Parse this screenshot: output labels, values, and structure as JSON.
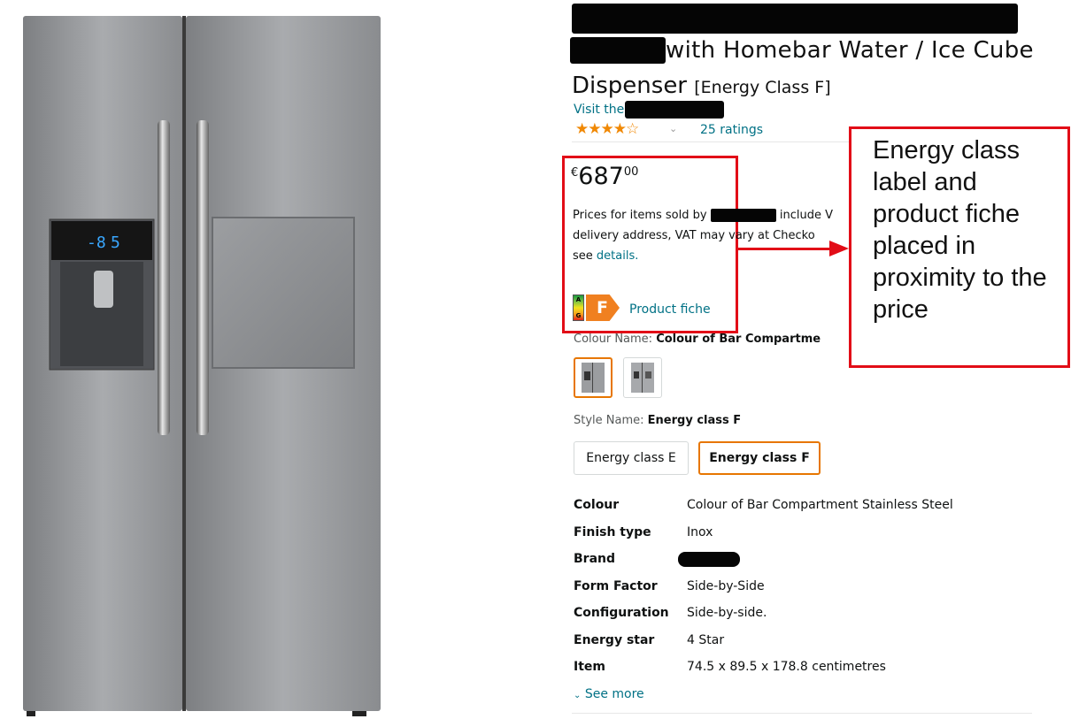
{
  "product": {
    "title_line2": "with Homebar Water / Ice Cube",
    "title_line3": "Dispenser",
    "title_energy": "[Energy Class F]",
    "visit_prefix": "Visit the",
    "stars": "★★★★☆",
    "ratings": "25 ratings"
  },
  "price": {
    "currency": "€",
    "whole": "687",
    "fraction": "00",
    "note_l1_a": "Prices for items sold by",
    "note_l1_b": "include V",
    "note_l2": "delivery address, VAT may vary at Checko",
    "note_l3_a": "see",
    "note_link": "details.",
    "energy_class_letter": "F",
    "scale_top": "A",
    "scale_bottom": "G",
    "fiche_label": "Product fiche"
  },
  "annotation": {
    "text": "Energy class label and product fiche placed in proximity to the price",
    "color": "#e20d17"
  },
  "colour": {
    "label": "Colour Name:",
    "selected": "Colour of Bar Compartme"
  },
  "style": {
    "label": "Style Name:",
    "selected": "Energy class F",
    "options": [
      "Energy class E",
      "Energy class F"
    ]
  },
  "specs": [
    {
      "key": "Colour",
      "value": "Colour of Bar Compartment Stainless Steel"
    },
    {
      "key": "Finish type",
      "value": "Inox"
    },
    {
      "key": "Brand",
      "value": ""
    },
    {
      "key": "Form Factor",
      "value": "Side-by-Side"
    },
    {
      "key": "Configuration",
      "value": "Side-by-side."
    },
    {
      "key": "Energy star",
      "value": "4 Star"
    },
    {
      "key": "Item",
      "value": "74.5 x 89.5 x 178.8 centimetres"
    }
  ],
  "see_more": "See more",
  "colors": {
    "link": "#007185",
    "star": "#f08804",
    "energy_orange": "#f08020",
    "selected_border": "#e77600"
  }
}
